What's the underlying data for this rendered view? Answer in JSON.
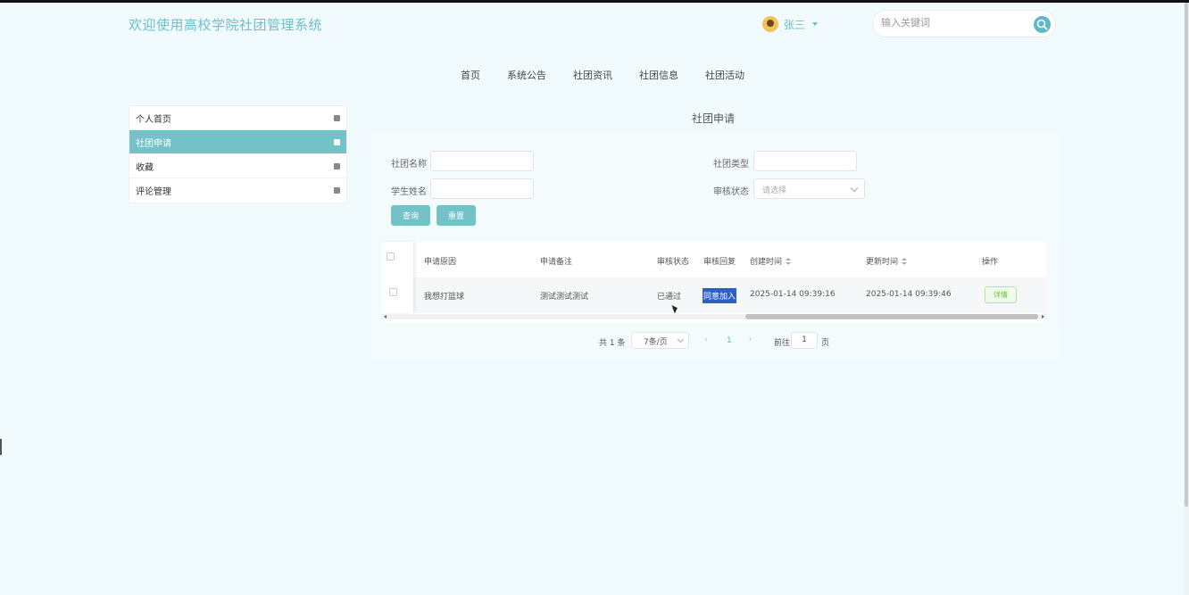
{
  "header": {
    "site_title": "欢迎使用高校学院社团管理系统",
    "user_name": "张三",
    "search_placeholder": "输入关键词"
  },
  "nav": {
    "items": [
      "首页",
      "系统公告",
      "社团资讯",
      "社团信息",
      "社团活动"
    ]
  },
  "sidebar": {
    "items": [
      {
        "label": "个人首页",
        "active": false
      },
      {
        "label": "社团申请",
        "active": true
      },
      {
        "label": "收藏",
        "active": false
      },
      {
        "label": "评论管理",
        "active": false
      }
    ]
  },
  "page": {
    "title": "社团申请"
  },
  "filters": {
    "club_name_label": "社团名称",
    "club_type_label": "社团类型",
    "student_name_label": "学生姓名",
    "review_status_label": "审核状态",
    "review_status_placeholder": "请选择",
    "query_button": "查询",
    "reset_button": "重置"
  },
  "table": {
    "columns": [
      "申请原因",
      "申请备注",
      "审核状态",
      "审核回复",
      "创建时间",
      "更新时间",
      "操作"
    ],
    "rows": [
      {
        "reason": "我想打篮球",
        "remark": "测试测试测试",
        "status": "已通过",
        "reply": "同意加入",
        "created": "2025-01-14 09:39:16",
        "updated": "2025-01-14 09:39:46",
        "action": "详情"
      }
    ]
  },
  "pagination": {
    "total_text": "共 1 条",
    "page_size": "7条/页",
    "current_page": "1",
    "goto_label": "前往",
    "goto_value": "1",
    "page_suffix": "页"
  },
  "colors": {
    "accent": "#73c2c8",
    "background": "#f1fbfe",
    "success": "#67c23a"
  }
}
